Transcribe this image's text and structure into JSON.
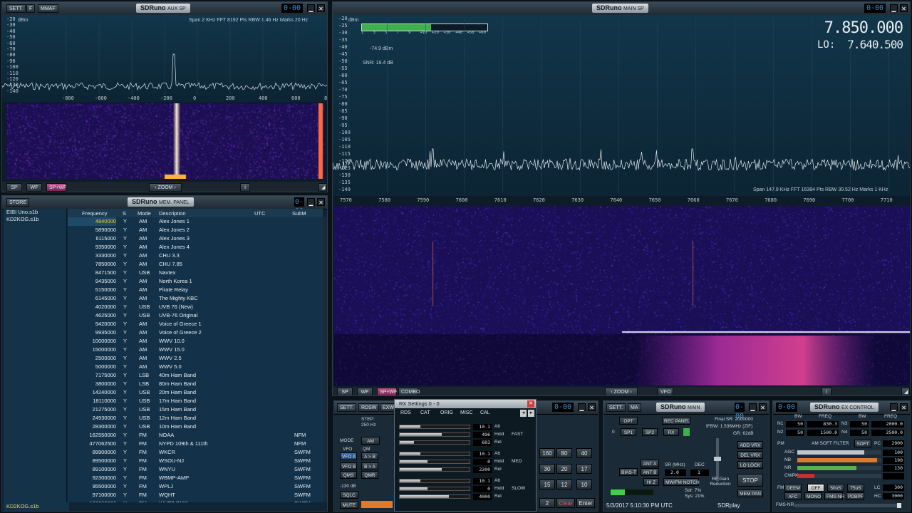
{
  "aux_sp": {
    "title": "SDRuno",
    "sub": "AUX SP",
    "lcd": "0-00",
    "buttons": [
      "SETT.",
      "F",
      "MMAF"
    ],
    "unit": "dBm",
    "info": "Span 2 KHz   FFT 8192 Pts   RBW 1.46 Hz   Marks 20 Hz",
    "y_ticks": [
      "-20",
      "-30",
      "-40",
      "-50",
      "-60",
      "-70",
      "-80",
      "-90",
      "-100",
      "-110",
      "-120",
      "-130",
      "-140"
    ],
    "x_ticks": [
      "-800",
      "-600",
      "-400",
      "-200",
      "0",
      "200",
      "400",
      "600",
      "800"
    ],
    "bottom_buttons": [
      "SP",
      "WF",
      "SP+WF"
    ],
    "zoom": "ZOOM"
  },
  "mem_panel": {
    "title": "SDRuno",
    "sub": "MEM. PANEL",
    "lcd": "0-00",
    "store": "STORE",
    "files": [
      "EIBI Uno.s1b",
      "KD2KOG.s1b"
    ],
    "status": "KD2KOG.s1b",
    "headers": [
      "Frequency",
      "S",
      "Mode",
      "Description",
      "UTC",
      "SubM"
    ],
    "rows": [
      [
        "4840000",
        "Y",
        "AM",
        "Alex Jones 1",
        ""
      ],
      [
        "5890000",
        "Y",
        "AM",
        "Alex Jones 2",
        ""
      ],
      [
        "6115000",
        "Y",
        "AM",
        "Alex Jones 3",
        ""
      ],
      [
        "9350000",
        "Y",
        "AM",
        "Alex Jones 4",
        ""
      ],
      [
        "3330000",
        "Y",
        "AM",
        "CHU 3.3",
        ""
      ],
      [
        "7850000",
        "Y",
        "AM",
        "CHU 7.85",
        ""
      ],
      [
        "8471500",
        "Y",
        "USB",
        "Navtex",
        ""
      ],
      [
        "9435000",
        "Y",
        "AM",
        "North Korea 1",
        ""
      ],
      [
        "5150000",
        "Y",
        "AM",
        "Pirate Relay",
        ""
      ],
      [
        "6145000",
        "Y",
        "AM",
        "The Mighty KBC",
        ""
      ],
      [
        "4020000",
        "Y",
        "USB",
        "UVB 76 (New)",
        ""
      ],
      [
        "4625000",
        "Y",
        "USB",
        "UVB-76 Original",
        ""
      ],
      [
        "9420000",
        "Y",
        "AM",
        "Voice of Greece 1",
        ""
      ],
      [
        "9935000",
        "Y",
        "AM",
        "Voice of Greece 2",
        ""
      ],
      [
        "10000000",
        "Y",
        "AM",
        "WWV 10.0",
        ""
      ],
      [
        "15000000",
        "Y",
        "AM",
        "WWV 15.0",
        ""
      ],
      [
        "2500000",
        "Y",
        "AM",
        "WWV 2.5",
        ""
      ],
      [
        "5000000",
        "Y",
        "AM",
        "WWV 5.0",
        ""
      ],
      [
        "7175000",
        "Y",
        "LSB",
        "40m Ham Band",
        ""
      ],
      [
        "3800000",
        "Y",
        "LSB",
        "80m Ham Band",
        ""
      ],
      [
        "14240000",
        "Y",
        "USB",
        "20m Ham Band",
        ""
      ],
      [
        "18110000",
        "Y",
        "USB",
        "17m Ham Band",
        ""
      ],
      [
        "21275000",
        "Y",
        "USB",
        "15m Ham Band",
        ""
      ],
      [
        "24930000",
        "Y",
        "USB",
        "12m Ham Band",
        ""
      ],
      [
        "28300000",
        "Y",
        "USB",
        "10m Ham Band",
        ""
      ],
      [
        "162550000",
        "Y",
        "FM",
        "NOAA",
        "NFM"
      ],
      [
        "477062500",
        "Y",
        "FM",
        "NYPD 109th & 111th",
        "NFM"
      ],
      [
        "89900000",
        "Y",
        "FM",
        "WKCR",
        "SWFM"
      ],
      [
        "89500000",
        "Y",
        "FM",
        "WSOU-NJ",
        "SWFM"
      ],
      [
        "89100000",
        "Y",
        "FM",
        "WNYU",
        "SWFM"
      ],
      [
        "92300000",
        "Y",
        "FM",
        "WBMP-AMP",
        "SWFM"
      ],
      [
        "95500000",
        "Y",
        "FM",
        "WPLJ",
        "SWFM"
      ],
      [
        "97100000",
        "Y",
        "FM",
        "WQHT",
        "SWFM"
      ],
      [
        "100300000",
        "Y",
        "FM",
        "WHTZ Z100",
        "SWFM"
      ]
    ]
  },
  "main_sp": {
    "title": "SDRuno",
    "sub": "MAIN SP",
    "lcd": "0-00",
    "unit": "dBm",
    "freq": "7.850.000",
    "lo_label": "LO:",
    "lo": "7.640.500",
    "level": "-74.9 dBm",
    "snr": "SNR: 19.4 dB",
    "smeter_labels": [
      "1",
      "3",
      "5",
      "7",
      "9",
      "+10",
      "+20",
      "+30",
      "+40",
      "+50",
      "+60"
    ],
    "smeter_level": 0.55,
    "info": "Span 147.9 KHz   FFT 16384 Pts   RBW 30.52 Hz   Marks 1 KHz",
    "y_ticks": [
      "-20",
      "-25",
      "-30",
      "-35",
      "-40",
      "-45",
      "-50",
      "-55",
      "-60",
      "-65",
      "-70",
      "-75",
      "-80",
      "-85",
      "-90",
      "-95",
      "-100",
      "-105",
      "-110",
      "-115",
      "-120",
      "-125",
      "-130",
      "-135",
      "-140"
    ],
    "x_ticks": [
      "7570",
      "7580",
      "7590",
      "7600",
      "7610",
      "7620",
      "7630",
      "7640",
      "7650",
      "7660",
      "7670",
      "7680",
      "7690",
      "7700",
      "7710"
    ],
    "bottom_buttons": [
      "SP",
      "WF",
      "SP+WF",
      "COMBO"
    ],
    "zoom": "ZOOM",
    "vfo": "VFO"
  },
  "rx_settings": {
    "title": "RX Settings 0 - 0",
    "tabs": [
      "RDS",
      "CAT",
      "ORIG",
      "MISC",
      "CAL"
    ],
    "groups": [
      {
        "rows": [
          [
            "10.1",
            "Att"
          ],
          [
            "496",
            "Hold"
          ],
          [
            "603",
            "Rel"
          ]
        ],
        "speed": "FAST"
      },
      {
        "rows": [
          [
            "10.1",
            "Att"
          ],
          [
            "0",
            "Hold"
          ],
          [
            "2200",
            "Rel"
          ]
        ],
        "speed": "MED"
      },
      {
        "rows": [
          [
            "10.1",
            "Att"
          ],
          [
            "0",
            "Hold"
          ],
          [
            "4000",
            "Rel"
          ]
        ],
        "speed": "SLOW"
      }
    ]
  },
  "rx_panel": {
    "sett": "SETT.",
    "rdsw": "RDSW",
    "exw": "EXW",
    "step": "STEP:",
    "step_val": "250 Hz",
    "mode": "MODE",
    "am": "AM",
    "qm": "QM",
    "vfo": "VFO",
    "vfo_a": "VFO A",
    "a_b": "A > B",
    "vfo_b": "VFO B",
    "b_a": "B > A",
    "qms": "QMS",
    "qmr": "QMR",
    "db130": "-130 dB",
    "sqlc": "SQLC",
    "mute": "MUTE",
    "lcd": "0-00",
    "keys": [
      "160",
      "80",
      "40",
      "30",
      "20",
      "17",
      "15",
      "12",
      "10",
      "2"
    ],
    "clear": "Clear",
    "enter": "Enter"
  },
  "main_panel": {
    "title": "SDRuno",
    "sub": "MAIN",
    "lcd": "0-00",
    "sett": "SETT.",
    "ma": "MA",
    "opt": "OPT",
    "rec": "REC PANEL",
    "sp1": "SP1",
    "sp2": "SP2",
    "rx": "RX",
    "zero": "0",
    "final_sr": "Final SR: 2000000",
    "ifbw": "IFBW: 1.536MHz (ZIF)",
    "gr": "GR: 62dB",
    "add_vrx": "ADD VRX",
    "del_vrx": "DEL VRX",
    "lo_lock": "LO LOCK",
    "ant_a": "ANT A",
    "bias_t": "BIAS-T",
    "ant_b": "ANT B",
    "sr_lbl": "SR (MHz)",
    "dec_lbl": "DEC",
    "sr_val": "2.0",
    "dec_val": "1",
    "hiz": "HI Z",
    "notch": "MW/FM NOTCH",
    "rfgain": "RF Gain Reduction",
    "stop": "STOP",
    "mem_pan": "MEM PAN",
    "sdr": "Sdr: 7%",
    "sys": "Sys: 21%",
    "datetime": "5/3/2017 5:10:30 PM UTC",
    "brand": "SDRplay"
  },
  "ex_control": {
    "title": "SDRuno",
    "sub": "EX CONTROL",
    "lcd": "0-00",
    "bw": "BW",
    "freq": "FREQ",
    "n1": "N1",
    "n2": "N2",
    "n3": "N3",
    "n4": "N4",
    "n1_bw": "50",
    "n1_freq": "830.3",
    "n3_bw": "50",
    "n3_freq": "2000.0",
    "n2_bw": "50",
    "n2_freq": "1500.0",
    "n4_bw": "50",
    "n4_freq": "2500.0",
    "pm": "PM",
    "am_soft": "AM SOFT FILTER",
    "soft": "SOFT",
    "pc": "PC",
    "pc_val": "2900",
    "sliders": [
      {
        "name": "AGC",
        "value": "100",
        "level": 0.8,
        "color": "#bfc7cc"
      },
      {
        "name": "NB",
        "value": "190",
        "level": 0.95,
        "color": "#e07a2a"
      },
      {
        "name": "NR",
        "value": "130",
        "level": 0.7,
        "color": "#5ab04a"
      },
      {
        "name": "CWPK",
        "value": "",
        "level": 0.2,
        "color": "#c83030"
      }
    ],
    "fm": "FM",
    "deem": "DEEM",
    "off": "OFF",
    "us50": "50uS",
    "us75": "75uS",
    "lc": "LC",
    "lc_val": "300",
    "afc": "AFC",
    "mono": "MONO",
    "fmsnr": "FMS-NR",
    "pdbpf": "PDBPF",
    "hc": "HC",
    "hc_val": "3000",
    "fmsnr2": "FMS-NR"
  }
}
